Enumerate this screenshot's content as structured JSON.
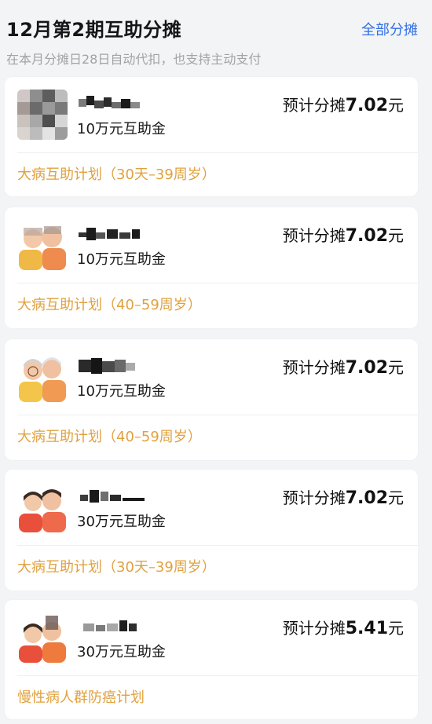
{
  "header": {
    "title": "12月第2期互助分摊",
    "link_label": "全部分摊",
    "subtitle": "在本月分摊日28日自动代扣，也支持主动支付"
  },
  "colors": {
    "accent": "#2f6ee8",
    "plan": "#e0a13e"
  },
  "cards": [
    {
      "fund": "10万元互助金",
      "amount_prefix": "预计分摊",
      "amount_value": "7.02",
      "amount_unit": "元",
      "plan": "大病互助计划（30天–39周岁）",
      "avatar_icon": "person-avatar-pixelated"
    },
    {
      "fund": "10万元互助金",
      "amount_prefix": "预计分摊",
      "amount_value": "7.02",
      "amount_unit": "元",
      "plan": "大病互助计划（40–59周岁）",
      "avatar_icon": "family-avatar-icon"
    },
    {
      "fund": "10万元互助金",
      "amount_prefix": "预计分摊",
      "amount_value": "7.02",
      "amount_unit": "元",
      "plan": "大病互助计划（40–59周岁）",
      "avatar_icon": "elderly-couple-avatar-icon"
    },
    {
      "fund": "30万元互助金",
      "amount_prefix": "预计分摊",
      "amount_value": "7.02",
      "amount_unit": "元",
      "plan": "大病互助计划（30天–39周岁）",
      "avatar_icon": "couple-avatar-icon"
    },
    {
      "fund": "30万元互助金",
      "amount_prefix": "预计分摊",
      "amount_value": "5.41",
      "amount_unit": "元",
      "plan": "慢性病人群防癌计划",
      "avatar_icon": "couple-avatar-icon"
    }
  ]
}
